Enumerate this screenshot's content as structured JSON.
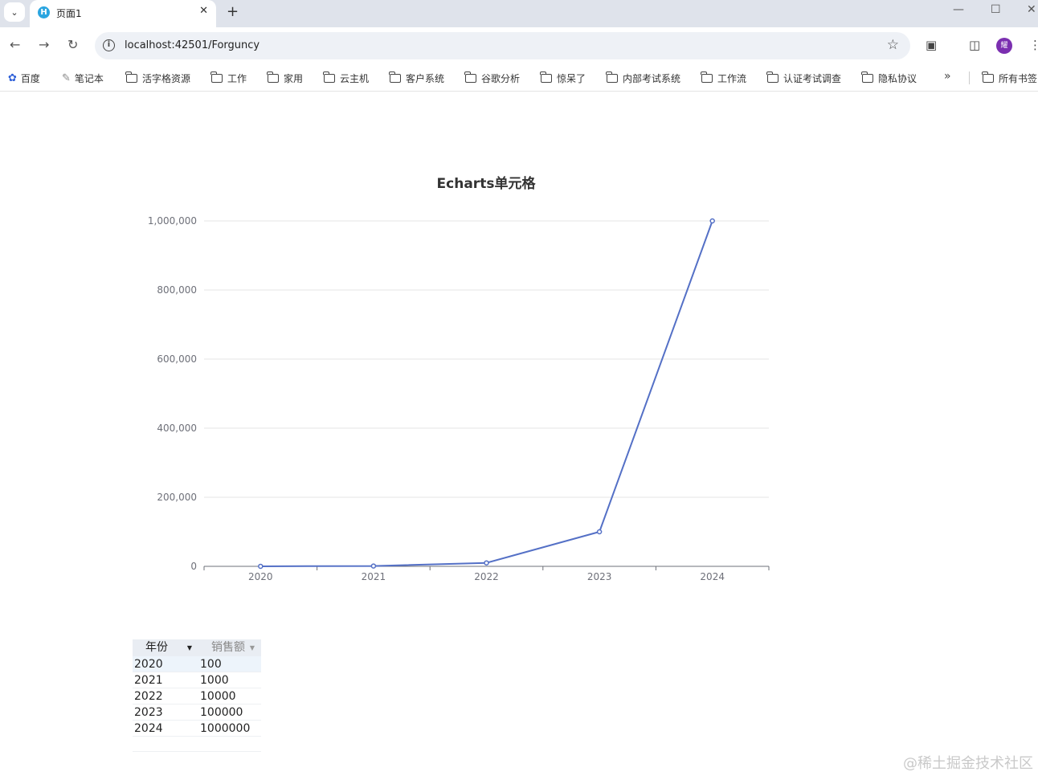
{
  "browser": {
    "tab_title": "页面1",
    "tab_favicon_letter": "H",
    "url": "localhost:42501/Forguncy",
    "avatar_letter": "耀",
    "bookmarks": [
      "百度",
      "笔记本",
      "活字格资源",
      "工作",
      "家用",
      "云主机",
      "客户系统",
      "谷歌分析",
      "惊呆了",
      "内部考试系统",
      "工作流",
      "认证考试调查",
      "隐私协议"
    ],
    "other_bookmarks": "所有书签"
  },
  "chart_data": {
    "type": "line",
    "title": "Echarts单元格",
    "categories": [
      "2020",
      "2021",
      "2022",
      "2023",
      "2024"
    ],
    "values": [
      100,
      1000,
      10000,
      100000,
      1000000
    ],
    "ylim": [
      0,
      1000000
    ],
    "y_ticks": [
      "0",
      "200,000",
      "400,000",
      "600,000",
      "800,000",
      "1,000,000"
    ],
    "grid": "horizontal",
    "line_color": "#5470c6"
  },
  "table": {
    "columns": [
      "年份",
      "销售额"
    ],
    "rows": [
      [
        "2020",
        "100"
      ],
      [
        "2021",
        "1000"
      ],
      [
        "2022",
        "10000"
      ],
      [
        "2023",
        "100000"
      ],
      [
        "2024",
        "1000000"
      ]
    ]
  },
  "watermark": "@稀土掘金技术社区"
}
